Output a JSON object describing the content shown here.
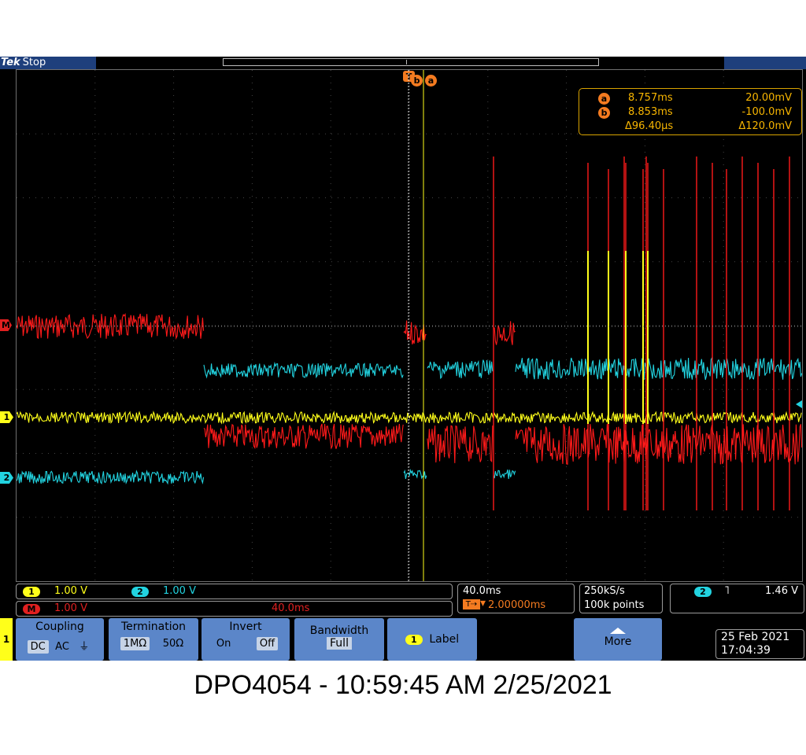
{
  "header": {
    "brand": "Tek",
    "acq_state": "Stop"
  },
  "cursor_readout": {
    "a_label": "a",
    "b_label": "b",
    "a_time": "8.757ms",
    "a_volt": "20.00mV",
    "b_time": "8.853ms",
    "b_volt": "-100.0mV",
    "delta_time": "Δ96.40μs",
    "delta_volt": "Δ120.0mV"
  },
  "markers": {
    "trigger": "T",
    "cursor_b": "b",
    "cursor_a": "a",
    "math": "M",
    "ch1": "1",
    "ch2": "2"
  },
  "status": {
    "ch1_tag": "1",
    "ch1_scale": "1.00 V",
    "ch2_tag": "2",
    "ch2_scale": "1.00 V",
    "math_tag": "M",
    "math_scale": "1.00 V",
    "math_time": "40.0ms",
    "timebase": "40.0ms",
    "trigger_pos": "2.00000ms",
    "sample_rate": "250kS/s",
    "record_length": "100k points",
    "trig_source": "2",
    "trig_level": "1.46 V"
  },
  "menu": {
    "side_tag": "1",
    "coupling": {
      "title": "Coupling",
      "options": [
        "DC",
        "AC",
        "⏚"
      ]
    },
    "termination": {
      "title": "Termination",
      "options": [
        "1MΩ",
        "50Ω"
      ]
    },
    "invert": {
      "title": "Invert",
      "options": [
        "On",
        "Off"
      ]
    },
    "bandwidth": {
      "title": "Bandwidth",
      "value": "Full"
    },
    "label_tag": "1",
    "label": "Label",
    "more": "More"
  },
  "datetime": {
    "date": "25 Feb  2021",
    "time": "17:04:39"
  },
  "caption": "DPO4054 - 10:59:45 AM   2/25/2021",
  "colors": {
    "ch1": "#ffff1a",
    "ch2": "#22d3e0",
    "math": "#ff1a1a",
    "cursor": "#f47b20",
    "panel_blue": "#1e3f7c",
    "menu_blue": "#5b86c9"
  }
}
